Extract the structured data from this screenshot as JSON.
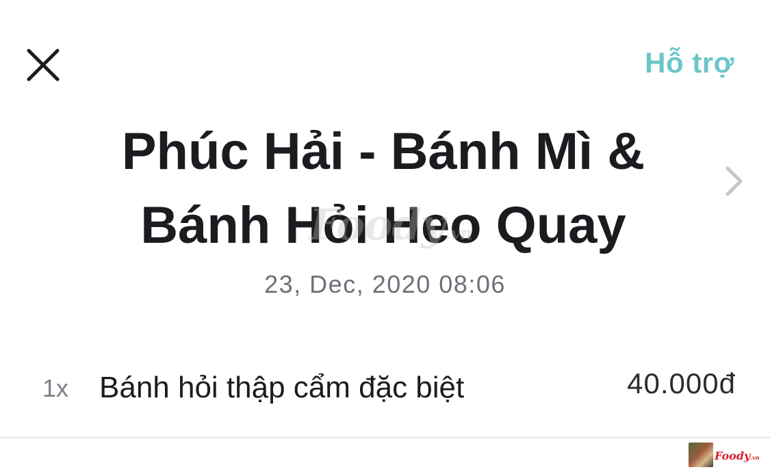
{
  "header": {
    "close_icon": "close-icon",
    "support_label": "Hỗ trợ",
    "support_color": "#6cc6c8"
  },
  "store": {
    "name": "Phúc Hải - Bánh Mì & Bánh Hỏi Heo Quay",
    "chevron_icon": "chevron-right-icon",
    "order_datetime": "23, Dec, 2020 08:06"
  },
  "order": {
    "items": [
      {
        "quantity": "1x",
        "name": "Bánh hỏi thập cẩm đặc biệt",
        "price": "40.000đ"
      }
    ]
  },
  "watermark": {
    "brand": "Foody",
    "suffix": ".vn"
  }
}
